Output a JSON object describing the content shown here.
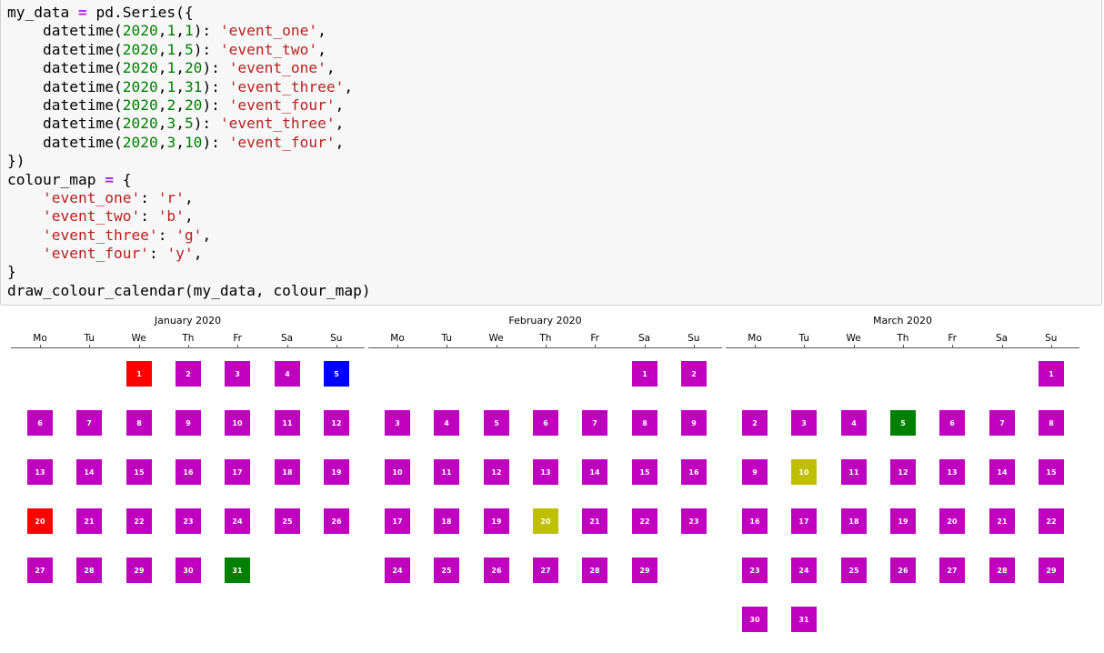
{
  "code_cell": {
    "lines": [
      [
        {
          "t": "my_data "
        },
        {
          "t": "=",
          "k": "o"
        },
        {
          "t": " pd.Series({"
        }
      ],
      [
        {
          "t": "    datetime("
        },
        {
          "t": "2020",
          "k": "n"
        },
        {
          "t": ","
        },
        {
          "t": "1",
          "k": "n"
        },
        {
          "t": ","
        },
        {
          "t": "1",
          "k": "n"
        },
        {
          "t": "): "
        },
        {
          "t": "'event_one'",
          "k": "s"
        },
        {
          "t": ","
        }
      ],
      [
        {
          "t": "    datetime("
        },
        {
          "t": "2020",
          "k": "n"
        },
        {
          "t": ","
        },
        {
          "t": "1",
          "k": "n"
        },
        {
          "t": ","
        },
        {
          "t": "5",
          "k": "n"
        },
        {
          "t": "): "
        },
        {
          "t": "'event_two'",
          "k": "s"
        },
        {
          "t": ","
        }
      ],
      [
        {
          "t": "    datetime("
        },
        {
          "t": "2020",
          "k": "n"
        },
        {
          "t": ","
        },
        {
          "t": "1",
          "k": "n"
        },
        {
          "t": ","
        },
        {
          "t": "20",
          "k": "n"
        },
        {
          "t": "): "
        },
        {
          "t": "'event_one'",
          "k": "s"
        },
        {
          "t": ","
        }
      ],
      [
        {
          "t": "    datetime("
        },
        {
          "t": "2020",
          "k": "n"
        },
        {
          "t": ","
        },
        {
          "t": "1",
          "k": "n"
        },
        {
          "t": ","
        },
        {
          "t": "31",
          "k": "n"
        },
        {
          "t": "): "
        },
        {
          "t": "'event_three'",
          "k": "s"
        },
        {
          "t": ","
        }
      ],
      [
        {
          "t": "    datetime("
        },
        {
          "t": "2020",
          "k": "n"
        },
        {
          "t": ","
        },
        {
          "t": "2",
          "k": "n"
        },
        {
          "t": ","
        },
        {
          "t": "20",
          "k": "n"
        },
        {
          "t": "): "
        },
        {
          "t": "'event_four'",
          "k": "s"
        },
        {
          "t": ","
        }
      ],
      [
        {
          "t": "    datetime("
        },
        {
          "t": "2020",
          "k": "n"
        },
        {
          "t": ","
        },
        {
          "t": "3",
          "k": "n"
        },
        {
          "t": ","
        },
        {
          "t": "5",
          "k": "n"
        },
        {
          "t": "): "
        },
        {
          "t": "'event_three'",
          "k": "s"
        },
        {
          "t": ","
        }
      ],
      [
        {
          "t": "    datetime("
        },
        {
          "t": "2020",
          "k": "n"
        },
        {
          "t": ","
        },
        {
          "t": "3",
          "k": "n"
        },
        {
          "t": ","
        },
        {
          "t": "10",
          "k": "n"
        },
        {
          "t": "): "
        },
        {
          "t": "'event_four'",
          "k": "s"
        },
        {
          "t": ","
        }
      ],
      [
        {
          "t": "})"
        }
      ],
      [
        {
          "t": "colour_map "
        },
        {
          "t": "=",
          "k": "o"
        },
        {
          "t": " {"
        }
      ],
      [
        {
          "t": "    "
        },
        {
          "t": "'event_one'",
          "k": "s"
        },
        {
          "t": ": "
        },
        {
          "t": "'r'",
          "k": "s"
        },
        {
          "t": ","
        }
      ],
      [
        {
          "t": "    "
        },
        {
          "t": "'event_two'",
          "k": "s"
        },
        {
          "t": ": "
        },
        {
          "t": "'b'",
          "k": "s"
        },
        {
          "t": ","
        }
      ],
      [
        {
          "t": "    "
        },
        {
          "t": "'event_three'",
          "k": "s"
        },
        {
          "t": ": "
        },
        {
          "t": "'g'",
          "k": "s"
        },
        {
          "t": ","
        }
      ],
      [
        {
          "t": "    "
        },
        {
          "t": "'event_four'",
          "k": "s"
        },
        {
          "t": ": "
        },
        {
          "t": "'y'",
          "k": "s"
        },
        {
          "t": ","
        }
      ],
      [
        {
          "t": "}"
        }
      ],
      [
        {
          "t": "draw_colour_calendar(my_data, colour_map)"
        }
      ]
    ]
  },
  "colors": {
    "default_day": "#bf00bf",
    "r": "#ff0000",
    "b": "#0000ff",
    "g": "#008000",
    "y": "#bfbf00"
  },
  "weekdays": [
    "Mo",
    "Tu",
    "We",
    "Th",
    "Fr",
    "Sa",
    "Su"
  ],
  "months": [
    {
      "title": "January 2020",
      "first_weekday": 2,
      "days": 31,
      "highlights": {
        "1": "r",
        "5": "b",
        "20": "r",
        "31": "g"
      }
    },
    {
      "title": "February 2020",
      "first_weekday": 5,
      "days": 29,
      "highlights": {
        "20": "y"
      }
    },
    {
      "title": "March 2020",
      "first_weekday": 6,
      "days": 31,
      "highlights": {
        "5": "g",
        "10": "y"
      }
    }
  ]
}
